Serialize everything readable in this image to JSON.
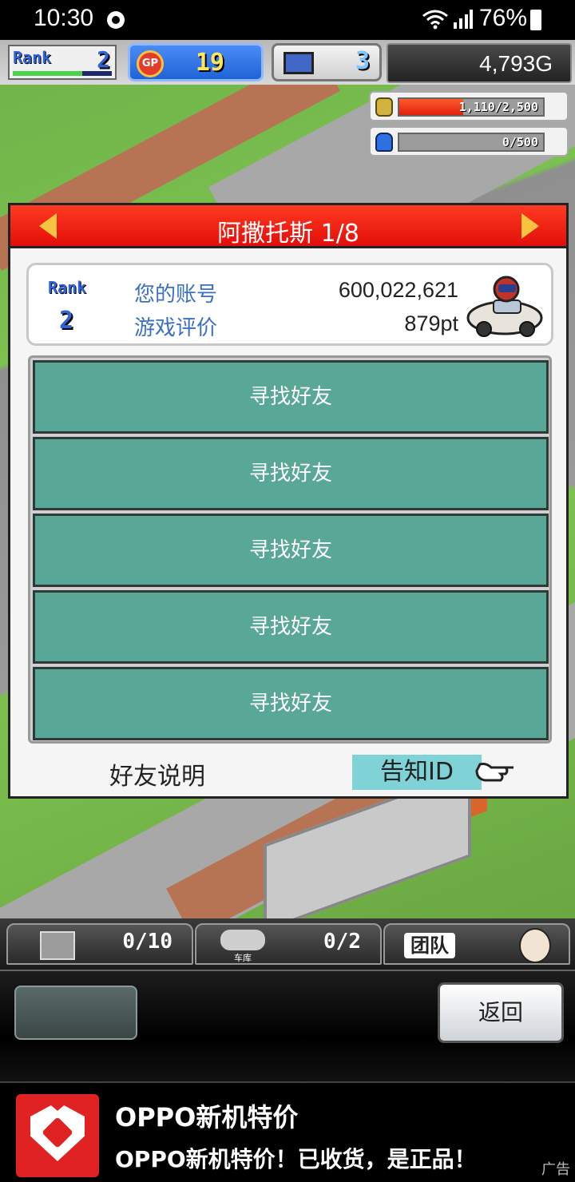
{
  "status_bar": {
    "time": "10:30",
    "battery_percent": "76%",
    "icons": [
      "game-notification-icon",
      "wifi-icon",
      "signal-icon",
      "battery-icon"
    ]
  },
  "hud": {
    "rank_label": "Rank",
    "rank_value": "2",
    "gp_label": "GP",
    "gp_value": "19",
    "pc_value": "3",
    "money": "4,793G",
    "gauge1_text": "1,110/2,500",
    "gauge1_fraction": 0.444,
    "gauge2_text": "0/500",
    "gauge2_fraction": 0
  },
  "dialog": {
    "title": "阿撒托斯 1/8",
    "profile": {
      "rank_label": "Rank",
      "rank_value": "2",
      "account_label": "您的账号",
      "account_value": "600,022,621",
      "rating_label": "游戏评价",
      "rating_value": "879pt"
    },
    "friend_slots": [
      "寻找好友",
      "寻找好友",
      "寻找好友",
      "寻找好友",
      "寻找好友"
    ],
    "help_label": "好友说明",
    "notify_label": "告知ID"
  },
  "toolbar": {
    "items_count": "0/10",
    "garage_label": "车库",
    "garage_count": "0/2",
    "team_label": "团队"
  },
  "command": {
    "back_label": "返回"
  },
  "ad": {
    "headline": "OPPO新机特价",
    "subline": "OPPO新机特价！已收货，是正品！",
    "tag": "广告"
  },
  "colors": {
    "header_red": "#e20f0a",
    "slot_teal": "#58a797",
    "notify_cyan": "#7fd2d6",
    "rank_blue": "#2f63d6"
  }
}
